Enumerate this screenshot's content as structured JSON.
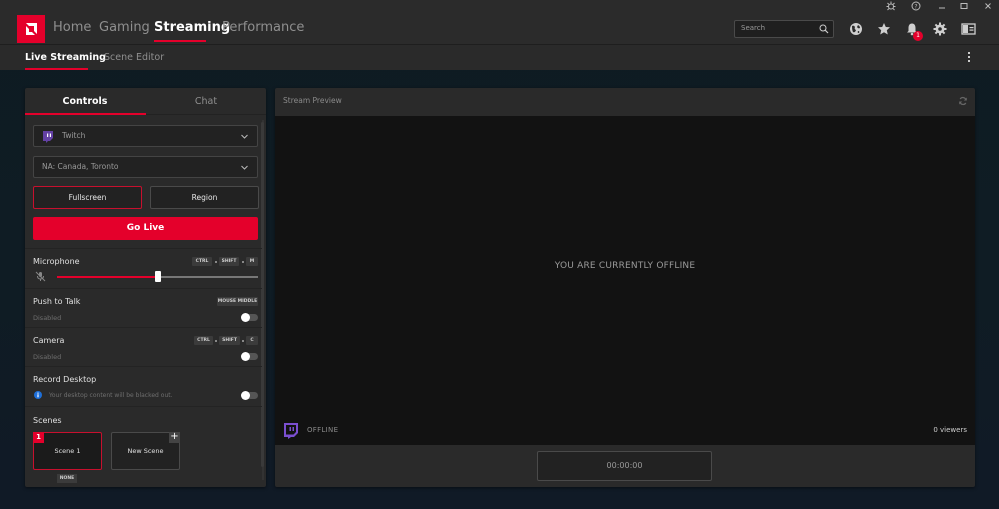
{
  "window_controls": {
    "icons": [
      "bug-icon",
      "help-icon",
      "minimize-icon",
      "maximize-icon",
      "close-icon"
    ]
  },
  "header": {
    "nav": [
      {
        "label": "Home",
        "active": false
      },
      {
        "label": "Gaming",
        "active": false
      },
      {
        "label": "Streaming",
        "active": true
      },
      {
        "label": "Performance",
        "active": false
      }
    ],
    "search_placeholder": "Search",
    "notification_count": "1",
    "accent_color": "#e4002b"
  },
  "subnav": {
    "items": [
      {
        "label": "Live Streaming",
        "active": true
      },
      {
        "label": "Scene Editor",
        "active": false
      }
    ]
  },
  "left_panel": {
    "tabs": [
      {
        "label": "Controls",
        "active": true
      },
      {
        "label": "Chat",
        "active": false
      }
    ],
    "platform": {
      "value": "Twitch"
    },
    "server": {
      "value": "NA: Canada, Toronto"
    },
    "capture_modes": [
      {
        "label": "Fullscreen",
        "selected": true
      },
      {
        "label": "Region",
        "selected": false
      }
    ],
    "go_live_label": "Go Live",
    "microphone": {
      "title": "Microphone",
      "hotkeys": [
        "CTRL",
        "SHIFT",
        "M"
      ],
      "volume_percent": 50,
      "muted": true
    },
    "push_to_talk": {
      "title": "Push to Talk",
      "hotkey": "MOUSE MIDDLE",
      "status": "Disabled",
      "enabled": false
    },
    "camera": {
      "title": "Camera",
      "hotkeys": [
        "CTRL",
        "SHIFT",
        "C"
      ],
      "status": "Disabled",
      "enabled": false
    },
    "record_desktop": {
      "title": "Record Desktop",
      "info": "Your desktop content will be blacked out.",
      "enabled": false
    },
    "scenes": {
      "title": "Scenes",
      "items": [
        {
          "number": "1",
          "label": "Scene 1",
          "hotkey": "NONE",
          "active": true
        },
        {
          "label": "New Scene",
          "add": "+"
        }
      ]
    }
  },
  "stream_preview": {
    "title": "Stream Preview",
    "message": "YOU ARE CURRENTLY OFFLINE",
    "status": "OFFLINE",
    "viewers": "0 viewers",
    "timer": "00:00:00"
  }
}
